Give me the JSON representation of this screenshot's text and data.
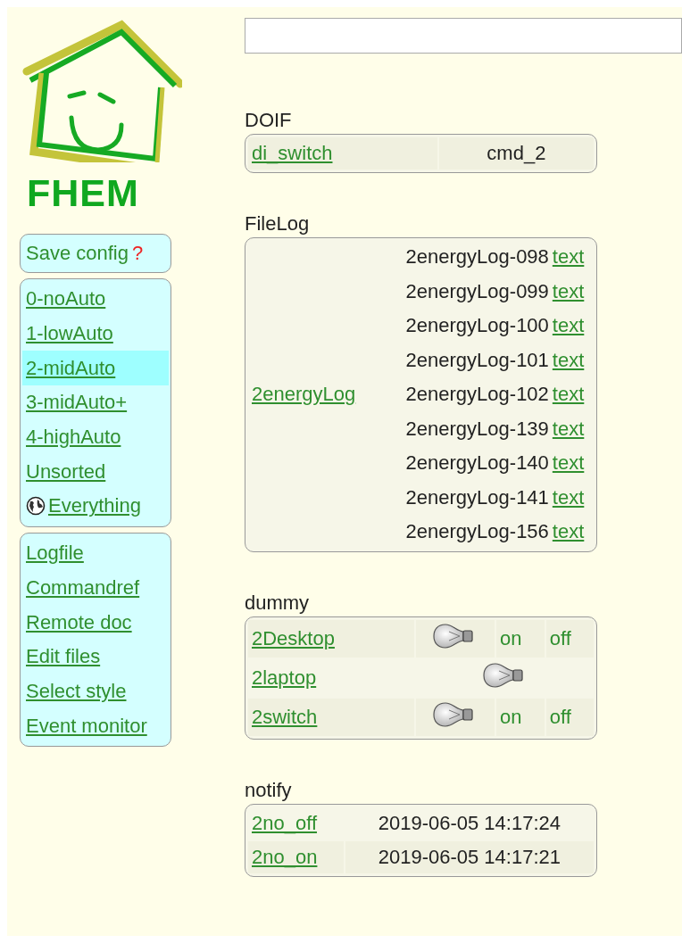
{
  "logo": {
    "text": "FHEM"
  },
  "save_config": {
    "label": "Save config",
    "mark": "?"
  },
  "rooms": [
    {
      "label": "0-noAuto",
      "selected": false,
      "kind": "room"
    },
    {
      "label": "1-lowAuto",
      "selected": false,
      "kind": "room"
    },
    {
      "label": "2-midAuto",
      "selected": true,
      "kind": "room"
    },
    {
      "label": "3-midAuto+",
      "selected": false,
      "kind": "room"
    },
    {
      "label": "4-highAuto",
      "selected": false,
      "kind": "room"
    },
    {
      "label": "Unsorted",
      "selected": false,
      "kind": "room"
    },
    {
      "label": "Everything",
      "selected": false,
      "kind": "all"
    }
  ],
  "links": [
    "Logfile",
    "Commandref",
    "Remote doc",
    "Edit files",
    "Select style",
    "Event monitor"
  ],
  "sections": [
    {
      "title": "DOIF",
      "kind": "doif",
      "rows": [
        {
          "name": "di_switch",
          "state": "cmd_2"
        }
      ]
    },
    {
      "title": "FileLog",
      "kind": "filelog",
      "name": "2energyLog",
      "files": [
        {
          "name": "2energyLog-098",
          "link": "text"
        },
        {
          "name": "2energyLog-099",
          "link": "text"
        },
        {
          "name": "2energyLog-100",
          "link": "text"
        },
        {
          "name": "2energyLog-101",
          "link": "text"
        },
        {
          "name": "2energyLog-102",
          "link": "text"
        },
        {
          "name": "2energyLog-139",
          "link": "text"
        },
        {
          "name": "2energyLog-140",
          "link": "text"
        },
        {
          "name": "2energyLog-141",
          "link": "text"
        },
        {
          "name": "2energyLog-156",
          "link": "text"
        }
      ]
    },
    {
      "title": "dummy",
      "kind": "dummy",
      "rows": [
        {
          "name": "2Desktop",
          "commands": [
            "on",
            "off"
          ]
        },
        {
          "name": "2laptop"
        },
        {
          "name": "2switch",
          "commands": [
            "on",
            "off"
          ]
        }
      ]
    },
    {
      "title": "notify",
      "kind": "notify",
      "rows": [
        {
          "name": "2no_off",
          "time": "2019-06-05 14:17:24"
        },
        {
          "name": "2no_on",
          "time": "2019-06-05 14:17:21"
        }
      ]
    }
  ]
}
